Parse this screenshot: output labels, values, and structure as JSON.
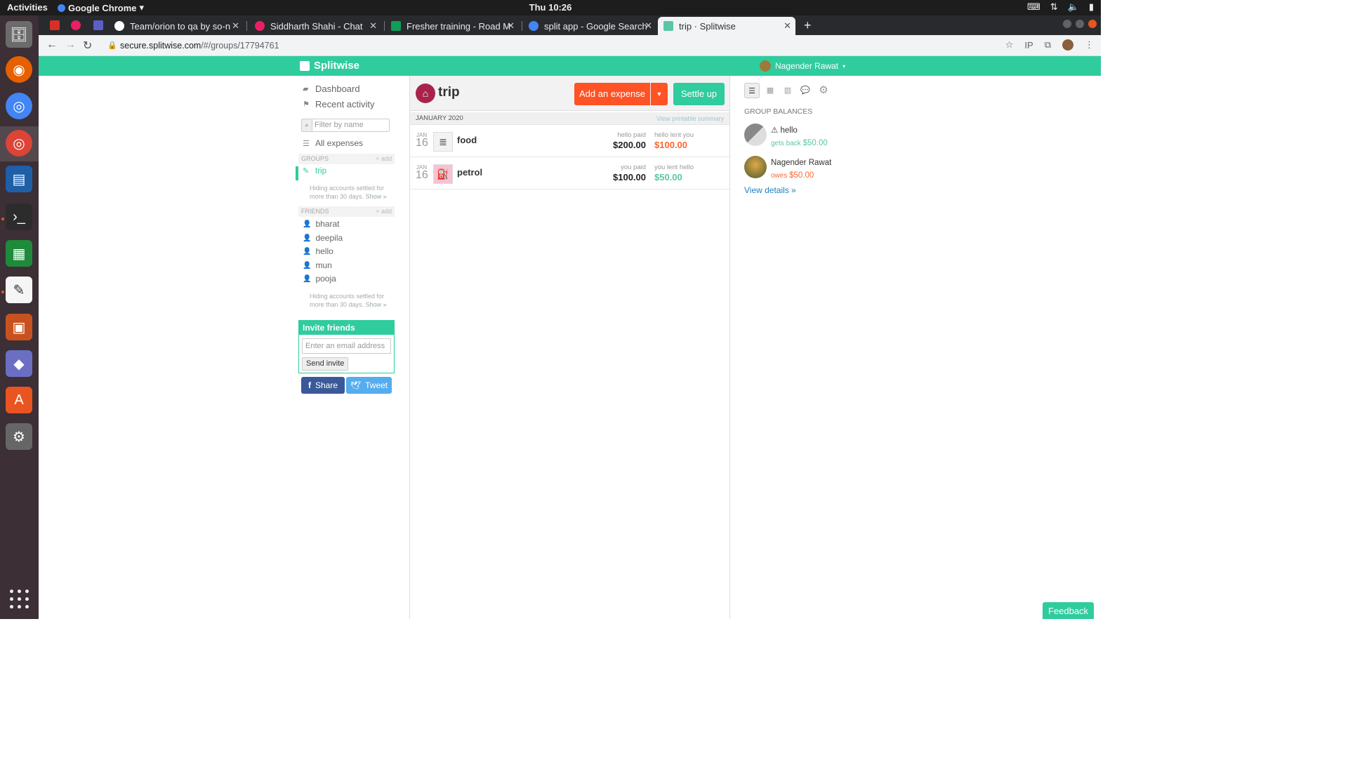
{
  "system": {
    "activities": "Activities",
    "app_name": "Google Chrome",
    "clock": "Thu 10:26"
  },
  "browser": {
    "tabs": [
      {
        "label": "Team/orion to qa by so-n",
        "favicon_color": "#ffffff"
      },
      {
        "label": "Siddharth Shahi - Chat",
        "favicon_color": "#e91e63"
      },
      {
        "label": "Fresher training - Road M",
        "favicon_color": "#0f9d58"
      },
      {
        "label": "split app - Google Search",
        "favicon_color": "#4285f4"
      },
      {
        "label": "trip · Splitwise",
        "favicon_color": "#5bc5a7"
      }
    ],
    "url_host": "secure.splitwise.com",
    "url_path": "/#/groups/17794761",
    "new_tab": "+",
    "ext_ip": "IP"
  },
  "header": {
    "logo": "Splitwise",
    "user_name": "Nagender Rawat"
  },
  "sidebar": {
    "dashboard": "Dashboard",
    "recent_activity": "Recent activity",
    "filter_placeholder": "Filter by name",
    "all_expenses": "All expenses",
    "groups_header": "GROUPS",
    "add_label": "+ add",
    "groups": [
      "trip"
    ],
    "hiding_text": "Hiding accounts settled for more than 30 days.",
    "show_link": "Show »",
    "friends_header": "FRIENDS",
    "friends": [
      "bharat",
      "deepila",
      "hello",
      "mun",
      "pooja"
    ],
    "invite_header": "Invite friends",
    "invite_placeholder": "Enter an email address",
    "send_invite": "Send invite",
    "share": "Share",
    "tweet": "Tweet"
  },
  "main": {
    "group_name": "trip",
    "add_expense": "Add an expense",
    "settle_up": "Settle up",
    "month": "JANUARY 2020",
    "printable": "View printable summary",
    "expenses": [
      {
        "month": "JAN",
        "day": "16",
        "description": "food",
        "paid_label": "hello paid",
        "paid_amount": "$200.00",
        "lent_label": "hello lent you",
        "lent_amount": "$100.00",
        "lent_color": "#ff652f"
      },
      {
        "month": "JAN",
        "day": "16",
        "description": "petrol",
        "paid_label": "you paid",
        "paid_amount": "$100.00",
        "lent_label": "you lent hello",
        "lent_amount": "$50.00",
        "lent_color": "#5bc5a7"
      }
    ]
  },
  "balances": {
    "title": "GROUP BALANCES",
    "items": [
      {
        "name": "hello",
        "status_label": "gets back",
        "amount": "$50.00",
        "color": "#5bc5a7"
      },
      {
        "name": "Nagender Rawat",
        "status_label": "owes",
        "amount": "$50.00",
        "color": "#ff652f"
      }
    ],
    "view_details": "View details »"
  },
  "feedback": "Feedback"
}
